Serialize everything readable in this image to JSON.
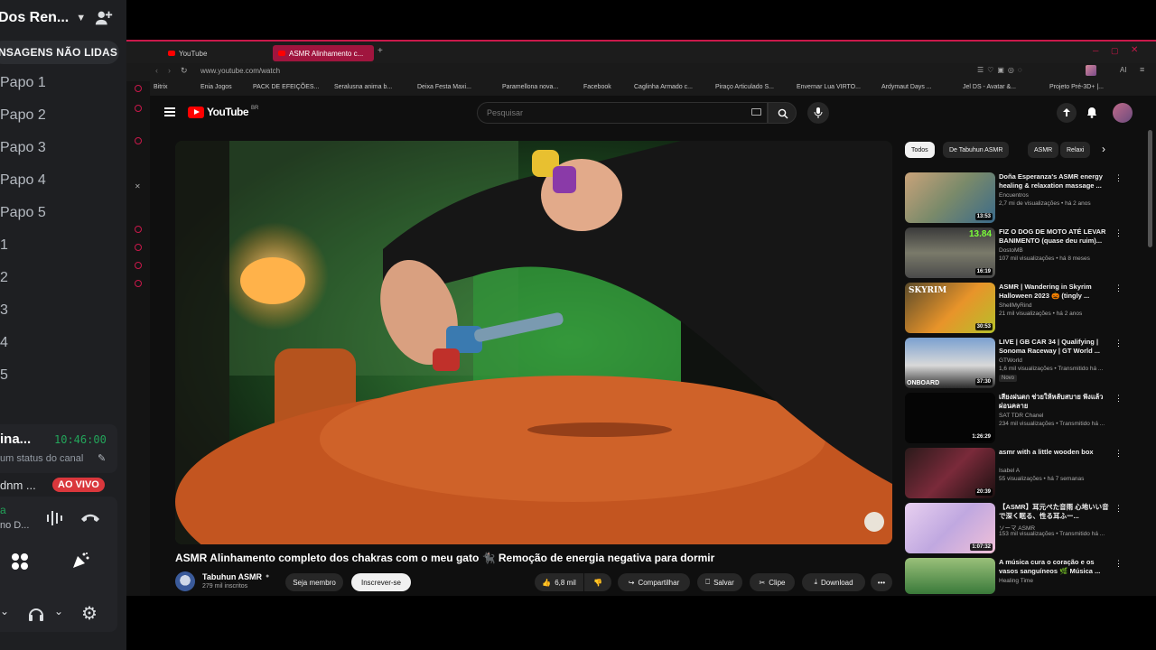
{
  "discord": {
    "server_name": "Dos Ren...",
    "unread_label": "NSAGENS NÃO LIDAS",
    "channels": [
      "Papo 1",
      "Papo 2",
      "Papo 3",
      "Papo 4",
      "Papo 5",
      "1",
      "2",
      "3",
      "4",
      "5"
    ],
    "user": {
      "name": "ina...",
      "time": "10:46:00",
      "status": "um status do canal"
    },
    "live_row": {
      "name": "dnm ...",
      "live_label": "AO VIVO"
    },
    "voice": {
      "line1": "a",
      "line2": "no D..."
    },
    "icons": [
      "invite-icon",
      "pencil-icon",
      "soundwave-icon",
      "hangup-icon",
      "apps-icon",
      "activity-icon",
      "chevron-down-icon",
      "headphones-icon",
      "gear-icon"
    ]
  },
  "browser": {
    "tabs": [
      {
        "label": "YouTube",
        "active": false
      },
      {
        "label": "ASMR Alinhamento c...",
        "active": true
      }
    ],
    "url": "www.youtube.com/watch",
    "bookmarks": [
      "Bitrix",
      "Enia Jogos",
      "PACK DE EFEIÇÕES...",
      "Seralusna anima b...",
      "Deixa Festa Maxi...",
      "Paramellona nova...",
      "Facebook",
      "Caglinha Armado c...",
      "Piraço Articulado S...",
      "Envernar Lua VIRTO...",
      "Ardymaut Days ...",
      "Jel DS - Avatar &...",
      "Projeto Pré-3D+ |..."
    ],
    "accent_color": "#c9184a"
  },
  "youtube": {
    "logo": "YouTube",
    "logo_suffix": "BR",
    "search_placeholder": "Pesquisar",
    "video": {
      "title": "ASMR Alinhamento completo dos chakras com o meu gato 🐈‍⬛ Remoção de energia negativa para dormir",
      "channel": "Tabuhun ASMR",
      "subscribers": "279 mil inscritos",
      "join_label": "Seja membro",
      "subscribe_label": "Inscrever-se",
      "likes": "6,8 mil",
      "share_label": "Compartilhar",
      "save_label": "Salvar",
      "clip_label": "Clipe",
      "download_label": "Download"
    },
    "chips": [
      "Todos",
      "De Tabuhun ASMR",
      "ASMR",
      "Relaxi"
    ],
    "recommendations": [
      {
        "title": "Doña Esperanza's ASMR energy healing & relaxation massage ...",
        "channel": "Encuentros",
        "meta": "2,7 mi de visualizações • há 2 anos",
        "duration": "13:53",
        "badge": ""
      },
      {
        "title": "FIZ O DOG DE MOTO ATÉ LEVAR BANIMENTO (quase deu ruim)...",
        "channel": "DostoMB",
        "meta": "107 mil visualizações • há 8 meses",
        "duration": "16:19",
        "badge": ""
      },
      {
        "title": "ASMR | Wandering in Skyrim Halloween 2023 🎃 (tingly ...",
        "channel": "ShellMyRind",
        "meta": "21 mil visualizações • há 2 anos",
        "duration": "30:53",
        "badge": ""
      },
      {
        "title": "LIVE | GB CAR 34 | Qualifying | Sonoma Raceway | GT World ...",
        "channel": "GTWorld",
        "meta": "1,6 mil visualizações • Transmitido há ...",
        "duration": "37:30",
        "badge": "Novo"
      },
      {
        "title": "เสียงฝนตก ช่วยให้หลับสบาย ฟังแล้วผ่อนคลาย",
        "channel": "SAT TDR Chanel",
        "meta": "234 mil visualizações • Transmitido há ...",
        "duration": "1:26:29",
        "badge": ""
      },
      {
        "title": "asmr with a little wooden box",
        "channel": "Isabel A",
        "meta": "55 visualizações • há 7 semanas",
        "duration": "20:39",
        "badge": ""
      },
      {
        "title": "【ASMR】耳元ぺた音雨 心地いい音で深く眠る、性る耳ふー...",
        "channel": "ソーマ ASMR",
        "meta": "153 mil visualizações • Transmitido há ...",
        "duration": "1:07:32",
        "badge": ""
      },
      {
        "title": "A música cura o coração e os vasos sanguíneos 🌿 Música ...",
        "channel": "Healing Time",
        "meta": "",
        "duration": "",
        "badge": ""
      }
    ]
  }
}
